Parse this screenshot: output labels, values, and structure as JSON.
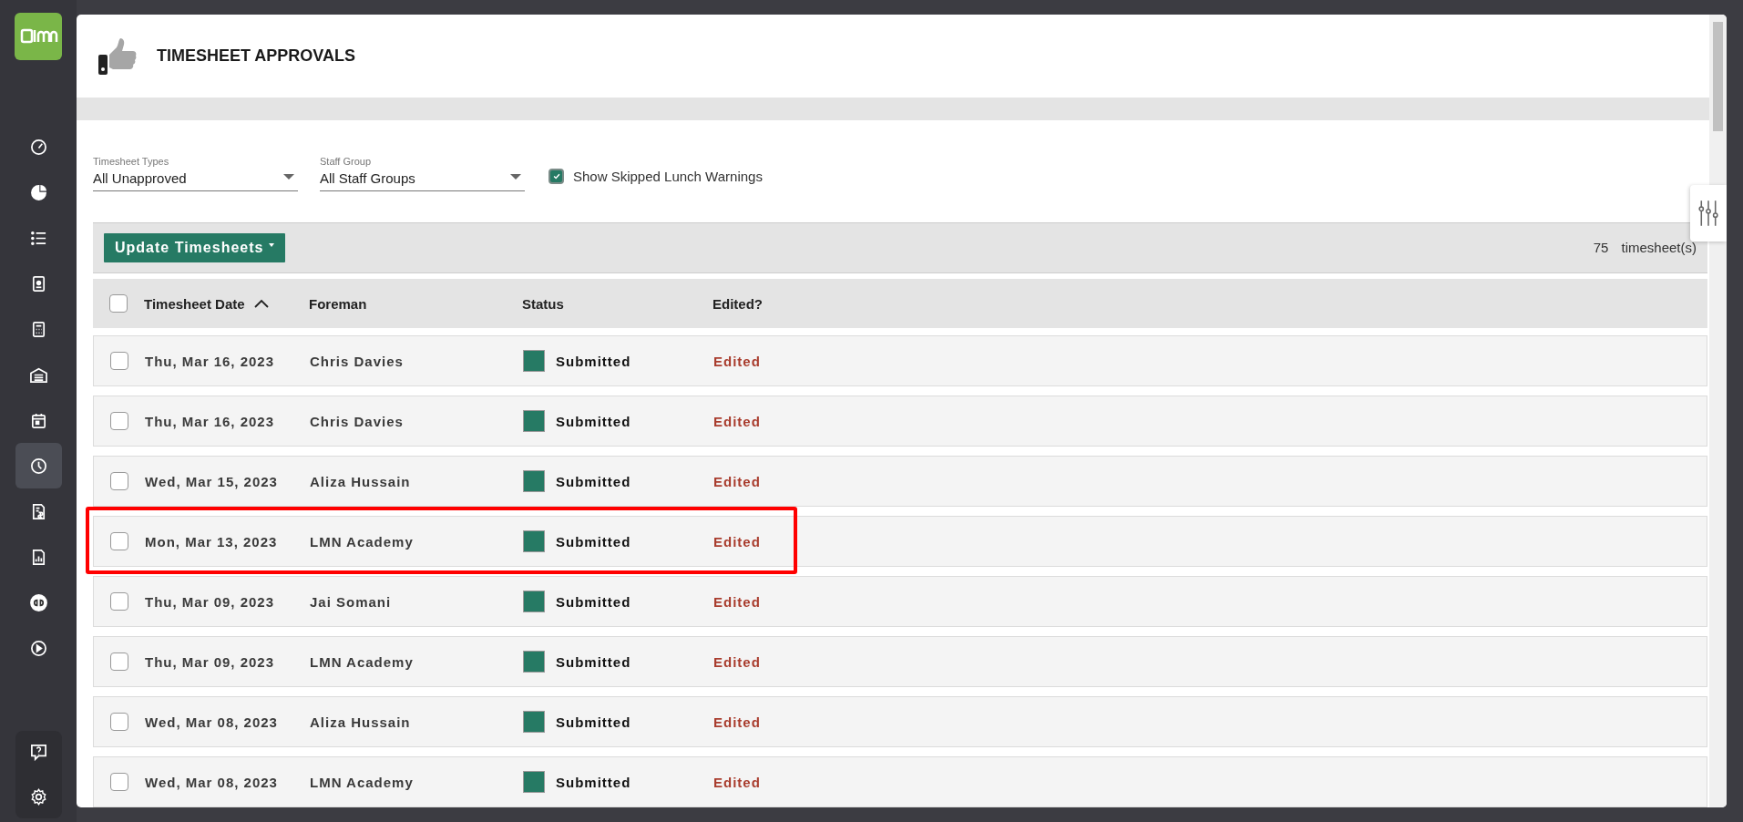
{
  "sidebar": {
    "items": [
      {
        "selected": false
      },
      {
        "selected": false
      },
      {
        "selected": false
      },
      {
        "selected": false
      },
      {
        "selected": false
      },
      {
        "selected": false
      },
      {
        "selected": false
      },
      {
        "selected": true
      },
      {
        "selected": false
      },
      {
        "selected": false
      },
      {
        "selected": false
      },
      {
        "selected": false
      }
    ]
  },
  "header": {
    "title": "TIMESHEET APPROVALS"
  },
  "filters": {
    "timesheet_types": {
      "label": "Timesheet Types",
      "value": "All Unapproved"
    },
    "staff_group": {
      "label": "Staff Group",
      "value": "All Staff Groups"
    },
    "skipped_lunch": {
      "label": "Show Skipped Lunch Warnings",
      "checked": true
    }
  },
  "toolbar": {
    "button": "Update Timesheets",
    "count": "75",
    "count_label": "timesheet(s)"
  },
  "table": {
    "all_checked": false,
    "columns": [
      "Timesheet Date",
      "Foreman",
      "Status",
      "Edited?"
    ],
    "sort_ascending": true,
    "rows": [
      {
        "date": "Thu, Mar 16, 2023",
        "foreman": "Chris Davies",
        "status": "Submitted",
        "edited": "Edited",
        "checked": false,
        "highlighted": false
      },
      {
        "date": "Thu, Mar 16, 2023",
        "foreman": "Chris Davies",
        "status": "Submitted",
        "edited": "Edited",
        "checked": false,
        "highlighted": false
      },
      {
        "date": "Wed, Mar 15, 2023",
        "foreman": "Aliza Hussain",
        "status": "Submitted",
        "edited": "Edited",
        "checked": false,
        "highlighted": false
      },
      {
        "date": "Mon, Mar 13, 2023",
        "foreman": "LMN Academy",
        "status": "Submitted",
        "edited": "Edited",
        "checked": false,
        "highlighted": true
      },
      {
        "date": "Thu, Mar 09, 2023",
        "foreman": "Jai Somani",
        "status": "Submitted",
        "edited": "Edited",
        "checked": false,
        "highlighted": false
      },
      {
        "date": "Thu, Mar 09, 2023",
        "foreman": "LMN Academy",
        "status": "Submitted",
        "edited": "Edited",
        "checked": false,
        "highlighted": false
      },
      {
        "date": "Wed, Mar 08, 2023",
        "foreman": "Aliza Hussain",
        "status": "Submitted",
        "edited": "Edited",
        "checked": false,
        "highlighted": false
      },
      {
        "date": "Wed, Mar 08, 2023",
        "foreman": "LMN Academy",
        "status": "Submitted",
        "edited": "Edited",
        "checked": false,
        "highlighted": false
      }
    ]
  }
}
